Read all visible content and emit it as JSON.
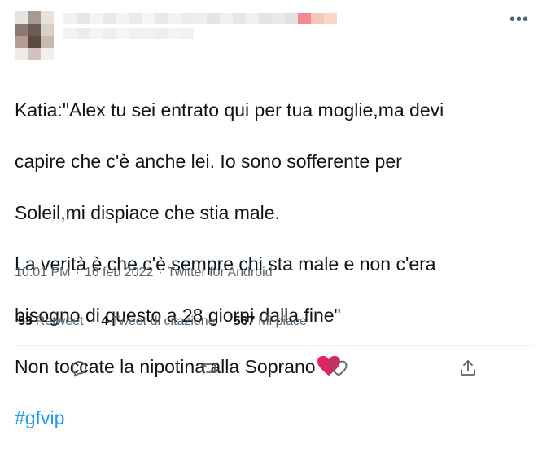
{
  "header": {
    "more_label": "•••"
  },
  "tweet": {
    "lines": [
      "Katia:\"Alex tu sei entrato qui per tua moglie,ma devi",
      "capire che c'è anche lei. Io sono sofferente per",
      "Soleil,mi dispiace che stia male.",
      "La verità è che c'è sempre chi sta male e non c'era",
      "bisogno di questo a 28 giorni dalla fine\"",
      "Non toccate la nipotina alla Soprano"
    ],
    "hashtag": "#gfvip"
  },
  "meta": {
    "time": "10:01 PM",
    "sep1": "·",
    "date": "16 feb 2022",
    "sep2": "·",
    "source": "Twitter for Android"
  },
  "stats": {
    "retweets_count": "53",
    "retweets_label": "Retweet",
    "quotes_count": "4",
    "quotes_label": "Tweet di citazione",
    "likes_count": "567",
    "likes_label": "Mi piace"
  },
  "colors": {
    "link": "#1d9bf0",
    "heart": "#e0245e",
    "secondary": "#536471"
  },
  "icons": {
    "reply": "speech-bubble",
    "retweet": "retweet-arrows",
    "like": "heart-outline",
    "share": "share-arrow-up",
    "emoji": "red-heart"
  }
}
